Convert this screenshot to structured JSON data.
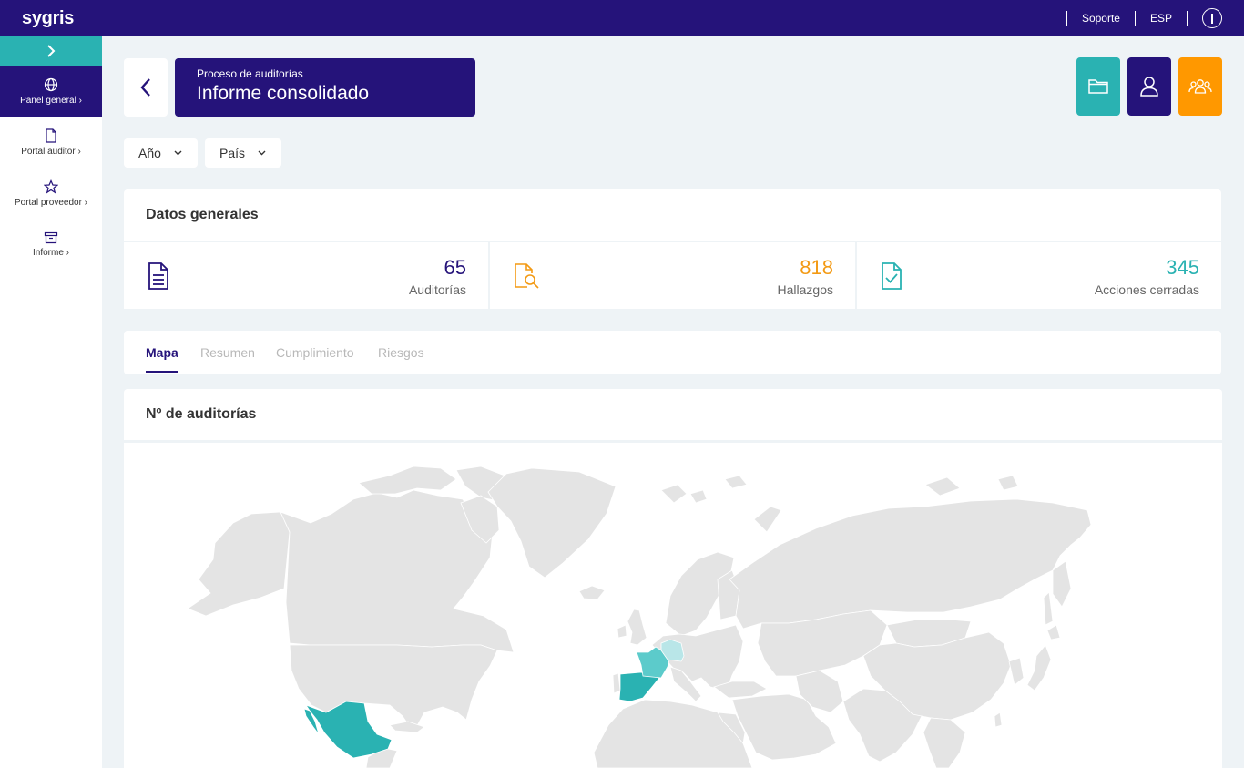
{
  "app": {
    "logo": "sygris"
  },
  "topbar": {
    "support": "Soporte",
    "language": "ESP",
    "info_icon": "info-icon"
  },
  "sidebar": {
    "items": [
      {
        "label": "Panel general",
        "icon": "globe-icon",
        "active": true
      },
      {
        "label": "Portal auditor",
        "icon": "document-icon",
        "active": false
      },
      {
        "label": "Portal proveedor",
        "icon": "star-icon",
        "active": false
      },
      {
        "label": "Informe",
        "icon": "archive-icon",
        "active": false
      }
    ]
  },
  "header": {
    "subtitle": "Proceso de auditorías",
    "title": "Informe consolidado"
  },
  "actions": {
    "folder_color": "#2ab2b2",
    "user_color": "#25137a",
    "group_color": "#ff9800"
  },
  "filters": {
    "year": "Año",
    "country": "País"
  },
  "general": {
    "title": "Datos generales",
    "stats": [
      {
        "value": "65",
        "label": "Auditorías",
        "color": "#25137a"
      },
      {
        "value": "818",
        "label": "Hallazgos",
        "color": "#f39a14"
      },
      {
        "value": "345",
        "label": "Acciones cerradas",
        "color": "#2ab2b2"
      }
    ]
  },
  "tabs": [
    "Mapa",
    "Resumen",
    "Cumplimiento",
    "Riesgos"
  ],
  "map": {
    "title": "Nº de auditorías",
    "highlighted_countries": [
      "Spain",
      "France",
      "Germany",
      "Mexico"
    ],
    "colors": {
      "land": "#e4e4e4",
      "high": "#2ab2b2",
      "mid": "#5ccbcb",
      "low": "#b9e6e8"
    }
  }
}
